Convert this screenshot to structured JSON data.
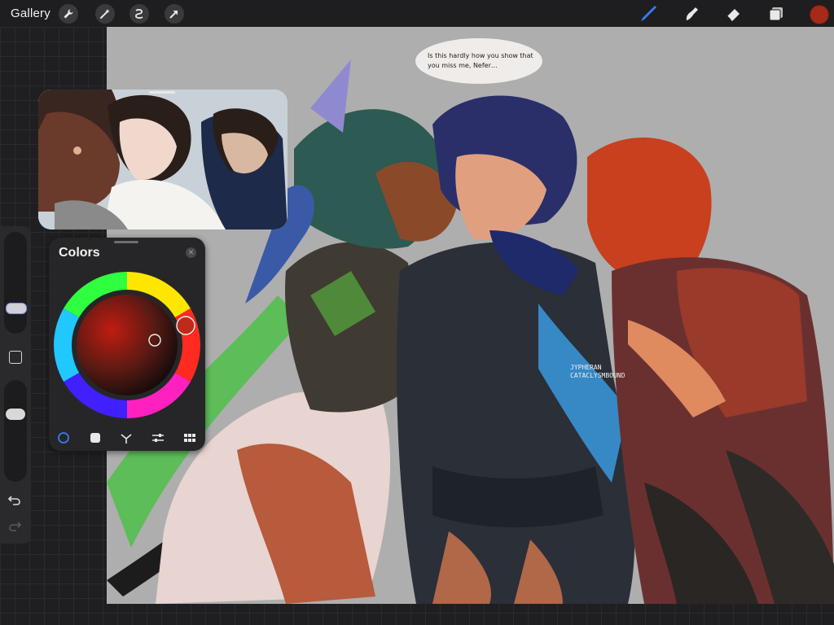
{
  "toolbar": {
    "gallery_label": "Gallery",
    "left_tools": [
      "wrench-icon",
      "magic-wand-icon",
      "selection-icon",
      "transform-arrow-icon"
    ],
    "right_tools": [
      "brush-icon",
      "smudge-icon",
      "eraser-icon",
      "layers-icon"
    ],
    "active_tool": "brush-icon",
    "current_color": "#a52a18",
    "accent_color": "#3a7bf2"
  },
  "canvas": {
    "speech_bubble_text": "Is this hardly how you show that you miss me, Nefer…",
    "watermark_line1": "JYPHERAN",
    "watermark_line2": "CATACLYSMBOUND"
  },
  "sidebar": {
    "brush_size_level": 0.72,
    "opacity_level": 0.27,
    "modify_button": "square-icon",
    "undo_icon": "undo-icon",
    "redo_icon": "redo-icon"
  },
  "colors_panel": {
    "title": "Colors",
    "close_icon": "close-icon",
    "tabs": [
      "disc-icon",
      "classic-icon",
      "harmony-icon",
      "value-icon",
      "palettes-icon"
    ],
    "active_tab": "disc-icon",
    "selected_color": "#c02a1a"
  },
  "reference_window": {
    "content": "photo-reference"
  }
}
